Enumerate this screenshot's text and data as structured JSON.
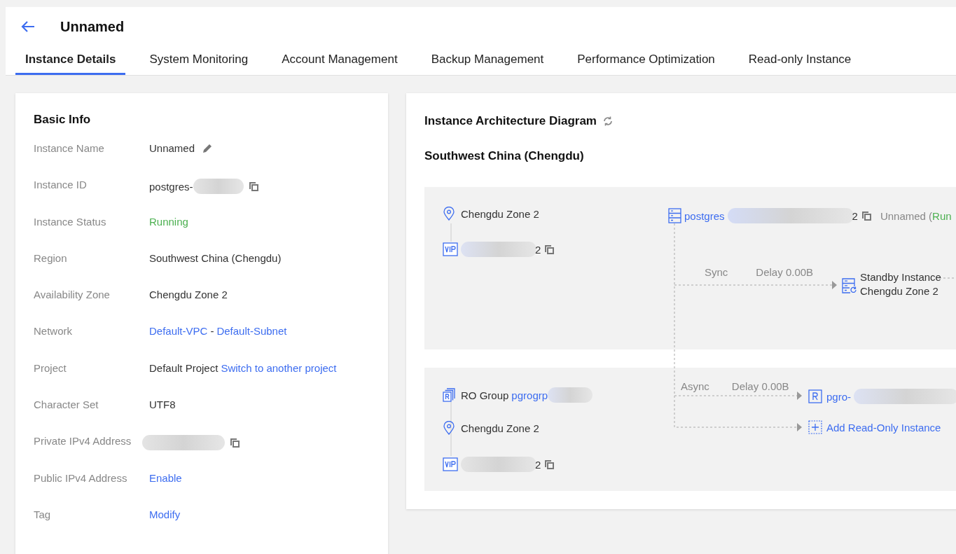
{
  "header": {
    "title": "Unnamed"
  },
  "tabs": [
    {
      "label": "Instance Details",
      "selected": true
    },
    {
      "label": "System Monitoring",
      "selected": false
    },
    {
      "label": "Account Management",
      "selected": false
    },
    {
      "label": "Backup Management",
      "selected": false
    },
    {
      "label": "Performance Optimization",
      "selected": false
    },
    {
      "label": "Read-only Instance",
      "selected": false
    }
  ],
  "basic_info": {
    "title": "Basic Info",
    "rows": [
      {
        "label": "Instance Name",
        "kind": "editable",
        "value": "Unnamed"
      },
      {
        "label": "Instance ID",
        "kind": "copy",
        "value": "postgres-"
      },
      {
        "label": "Instance Status",
        "kind": "status",
        "value": "Running"
      },
      {
        "label": "Region",
        "kind": "text",
        "value": "Southwest China (Chengdu)"
      },
      {
        "label": "Availability Zone",
        "kind": "text",
        "value": "Chengdu Zone 2"
      },
      {
        "label": "Network",
        "kind": "network",
        "links": [
          "Default-VPC",
          "Default-Subnet"
        ],
        "separator": "-"
      },
      {
        "label": "Project",
        "kind": "project",
        "value": "Default Project",
        "link": "Switch to another project"
      },
      {
        "label": "Character Set",
        "kind": "text",
        "value": "UTF8"
      },
      {
        "label": "Private IPv4 Address",
        "kind": "copy"
      },
      {
        "label": "Public IPv4 Address",
        "kind": "link",
        "value": "Enable"
      },
      {
        "label": "Tag",
        "kind": "link",
        "value": "Modify"
      }
    ]
  },
  "diagram": {
    "title": "Instance Architecture Diagram",
    "region": "Southwest China (Chengdu)",
    "primary": {
      "zone": "Chengdu Zone 2",
      "vip_tail": "2",
      "instance_id": "postgres",
      "instance_tail": "2",
      "name": "Unnamed (",
      "status": "Run"
    },
    "standby": {
      "sync": "Sync",
      "delay": "Delay 0.00B",
      "title": "Standby Instance",
      "zone": "Chengdu Zone 2"
    },
    "ro_group": {
      "label": "RO Group",
      "id": "pgrogrp",
      "zone": "Chengdu Zone 2",
      "vip_tail": "2",
      "sync": "Async",
      "delay": "Delay 0.00B",
      "instance_id": "pgro-",
      "add": "Add Read-Only Instance"
    }
  }
}
